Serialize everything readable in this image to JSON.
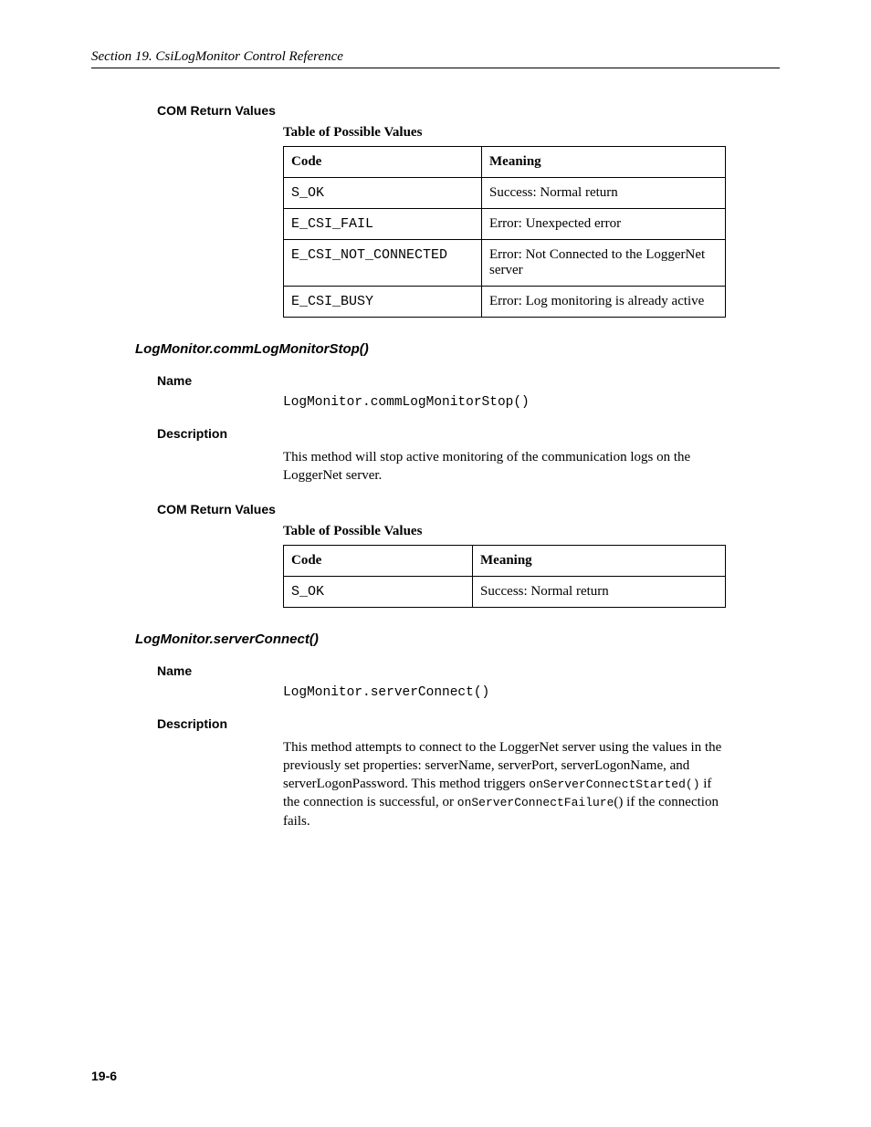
{
  "header": "Section 19.  CsiLogMonitor Control Reference",
  "block1": {
    "heading": "COM Return Values",
    "tableCaption": "Table of Possible Values",
    "thCode": "Code",
    "thMeaning": "Meaning",
    "rows": [
      {
        "code": "S_OK",
        "meaning": "Success: Normal return"
      },
      {
        "code": "E_CSI_FAIL",
        "meaning": "Error: Unexpected error"
      },
      {
        "code": "E_CSI_NOT_CONNECTED",
        "meaning": "Error: Not Connected to the LoggerNet server"
      },
      {
        "code": "E_CSI_BUSY",
        "meaning": "Error: Log monitoring is already active"
      }
    ]
  },
  "method1": {
    "title": "LogMonitor.commLogMonitorStop()",
    "nameLabel": "Name",
    "nameValue": "LogMonitor.commLogMonitorStop()",
    "descLabel": "Description",
    "descText": "This method will stop active monitoring of the communication logs on the LoggerNet server.",
    "comLabel": "COM Return Values",
    "tableCaption": "Table of Possible Values",
    "thCode": "Code",
    "thMeaning": "Meaning",
    "rows": [
      {
        "code": "S_OK",
        "meaning": "Success: Normal return"
      }
    ]
  },
  "method2": {
    "title": "LogMonitor.serverConnect()",
    "nameLabel": "Name",
    "nameValue": "LogMonitor.serverConnect()",
    "descLabel": "Description",
    "descPre": "This method attempts to connect to the LoggerNet server using the values in the previously set properties: serverName, serverPort, serverLogonName, and serverLogonPassword.  This method triggers ",
    "descCode1": "onServerConnectStarted()",
    "descMid": " if the connection is successful, or ",
    "descCode2": "onServerConnectFailure",
    "descPost": "() if the connection fails."
  },
  "pageNum": "19-6"
}
